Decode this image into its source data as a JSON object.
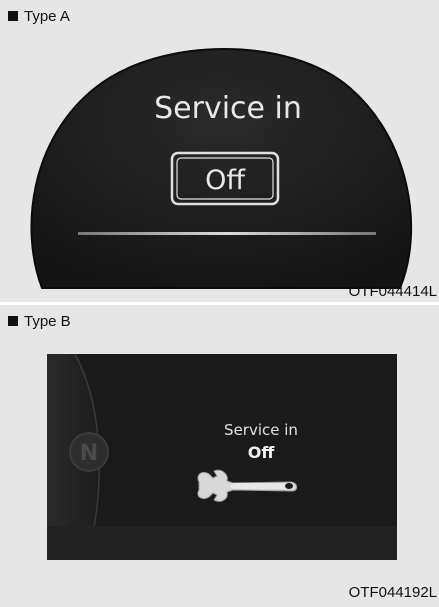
{
  "type_a": {
    "label": "Type A",
    "title": "Service in",
    "value": "Off",
    "code": "OTF044414L"
  },
  "type_b": {
    "label": "Type B",
    "title": "Service in",
    "value": "Off",
    "gear_indicator": "N",
    "icon": "wrench-icon",
    "code": "OTF044192L"
  },
  "colors": {
    "panel_background": "#e6e6e6",
    "display_black": "#1a1a1a",
    "display_text": "#e8e8e8"
  }
}
